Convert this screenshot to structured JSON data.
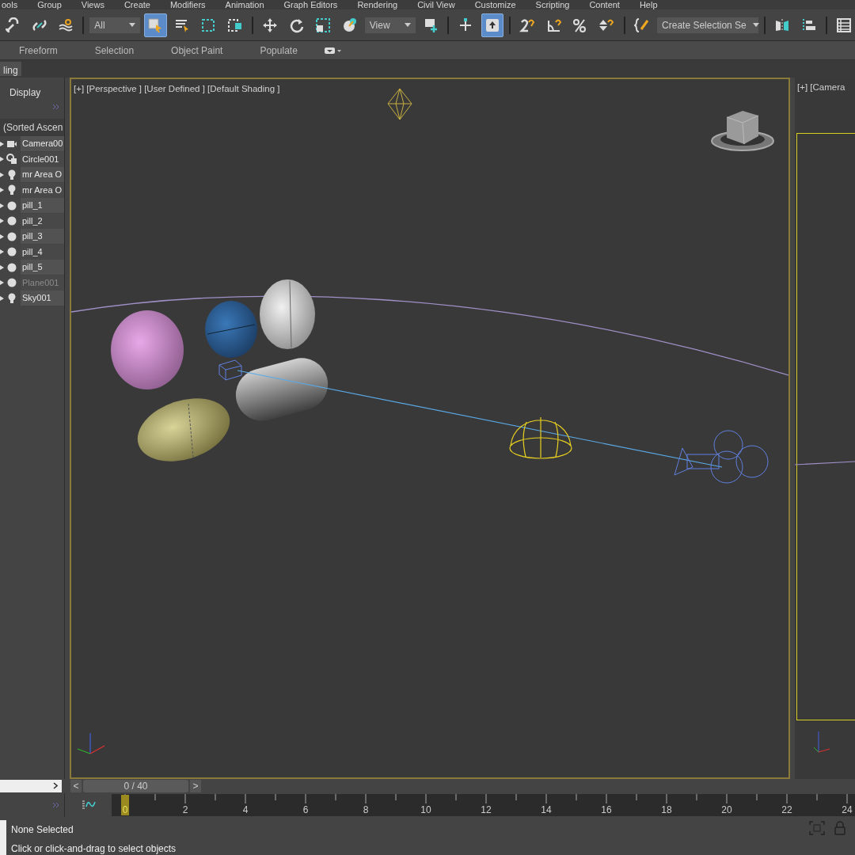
{
  "menu": [
    "ools",
    "Group",
    "Views",
    "Create",
    "Modifiers",
    "Animation",
    "Graph Editors",
    "Rendering",
    "Civil View",
    "Customize",
    "Scripting",
    "Content",
    "Help"
  ],
  "toolbar": [
    {
      "kind": "button",
      "selected": false
    },
    {
      "kind": "button",
      "selected": false
    },
    {
      "kind": "button",
      "selected": false
    },
    {
      "kind": "separator"
    },
    {
      "kind": "dropdown",
      "label": "All"
    },
    {
      "kind": "button",
      "selected": true
    },
    {
      "kind": "button",
      "selected": false
    },
    {
      "kind": "button",
      "selected": false
    },
    {
      "kind": "button",
      "selected": false
    },
    {
      "kind": "separator"
    },
    {
      "kind": "button",
      "selected": false
    },
    {
      "kind": "button",
      "selected": false
    },
    {
      "kind": "button",
      "selected": false
    },
    {
      "kind": "button",
      "selected": false
    },
    {
      "kind": "dropdown",
      "label": "View"
    },
    {
      "kind": "button",
      "selected": false
    },
    {
      "kind": "separator"
    },
    {
      "kind": "button",
      "selected": false
    },
    {
      "kind": "button",
      "selected": true
    },
    {
      "kind": "separator"
    },
    {
      "kind": "button",
      "selected": false
    },
    {
      "kind": "button",
      "selected": false
    },
    {
      "kind": "button",
      "selected": false
    },
    {
      "kind": "button",
      "selected": false
    },
    {
      "kind": "separator"
    },
    {
      "kind": "button",
      "selected": false
    },
    {
      "kind": "dropdown",
      "label": "Create Selection Se"
    },
    {
      "kind": "separator"
    },
    {
      "kind": "button",
      "selected": false
    },
    {
      "kind": "button",
      "selected": false
    },
    {
      "kind": "separator"
    },
    {
      "kind": "button",
      "selected": false
    }
  ],
  "ribbon_tabs": [
    "Freeform",
    "Selection",
    "Object Paint",
    "Populate"
  ],
  "command_tab": "ling",
  "scene_explorer": {
    "tab": "Display",
    "header": "(Sorted Ascen",
    "items": [
      {
        "name": "Camera00",
        "kind": "camera",
        "dimmed": false
      },
      {
        "name": "Circle001",
        "kind": "shape",
        "dimmed": false
      },
      {
        "name": "mr Area O",
        "kind": "light",
        "dimmed": false
      },
      {
        "name": "mr Area O",
        "kind": "light",
        "dimmed": false
      },
      {
        "name": "pill_1",
        "kind": "geometry",
        "dimmed": false
      },
      {
        "name": "pill_2",
        "kind": "geometry",
        "dimmed": false
      },
      {
        "name": "pill_3",
        "kind": "geometry",
        "dimmed": false
      },
      {
        "name": "pill_4",
        "kind": "geometry",
        "dimmed": false
      },
      {
        "name": "pill_5",
        "kind": "geometry",
        "dimmed": false
      },
      {
        "name": "Plane001",
        "kind": "geometry",
        "dimmed": true
      },
      {
        "name": "Sky001",
        "kind": "light",
        "dimmed": false
      }
    ]
  },
  "viewport": {
    "label": "[+] [Perspective ] [User Defined ] [Default Shading ]"
  },
  "camera_viewport": {
    "label": "[+] [Camera"
  },
  "time_slider": {
    "frame": "0 / 40",
    "prev": "<",
    "next": ">",
    "level": 0
  },
  "timeline": {
    "ticks": [
      {
        "label": "0",
        "selected": true
      },
      {
        "label": "2",
        "selected": false
      },
      {
        "label": "4",
        "selected": false
      },
      {
        "label": "6",
        "selected": false
      },
      {
        "label": "8",
        "selected": false
      },
      {
        "label": "10",
        "selected": false
      },
      {
        "label": "12",
        "selected": false
      },
      {
        "label": "14",
        "selected": false
      },
      {
        "label": "16",
        "selected": false
      },
      {
        "label": "18",
        "selected": false
      },
      {
        "label": "20",
        "selected": false
      },
      {
        "label": "22",
        "selected": false
      },
      {
        "label": "24",
        "selected": false
      }
    ]
  },
  "status_bar": {
    "selection": "None Selected",
    "prompt": "Click or click-and-drag to select objects"
  }
}
